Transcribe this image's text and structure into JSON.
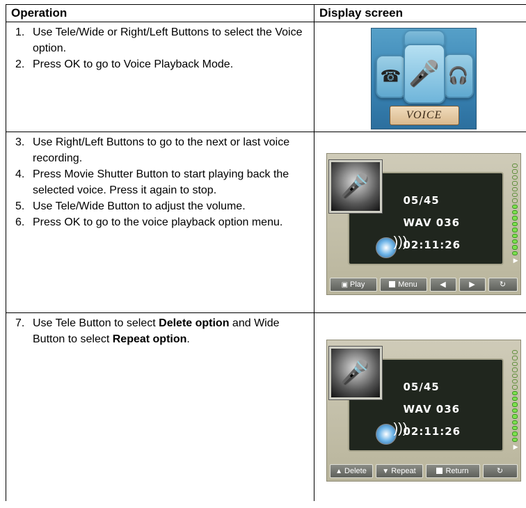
{
  "header": {
    "operation": "Operation",
    "display_screen": "Display screen"
  },
  "rows": [
    {
      "steps": [
        {
          "num": "1.",
          "text": "Use Tele/Wide or Right/Left Buttons to select the Voice option."
        },
        {
          "num": "2.",
          "text": "Press OK to go to Voice Playback Mode."
        }
      ],
      "screen": {
        "banner": "VOICE"
      }
    },
    {
      "steps": [
        {
          "num": "3.",
          "text": "Use Right/Left Buttons to go to the next or last voice recording."
        },
        {
          "num": "4.",
          "text": "Press Movie Shutter Button to start playing back the selected voice. Press it again to stop."
        },
        {
          "num": "5.",
          "text": "Use Tele/Wide Button to adjust the volume."
        },
        {
          "num": "6.",
          "text": "Press OK to go to the voice playback option menu."
        }
      ],
      "screen": {
        "count": "05/45",
        "file": "WAV 036",
        "time": "02:11:26",
        "volume_level": 0.55,
        "buttons": [
          "Play",
          "Menu"
        ]
      }
    },
    {
      "steps": [
        {
          "num": "7.",
          "pre": "Use Tele Button to select ",
          "b1": "Delete option",
          "mid": " and Wide Button to select ",
          "b2": "Repeat option",
          "post": "."
        }
      ],
      "screen": {
        "count": "05/45",
        "file": "WAV 036",
        "time": "02:11:26",
        "volume_level": 0.55,
        "buttons": [
          "Delete",
          "Repeat",
          "Return"
        ]
      }
    }
  ]
}
